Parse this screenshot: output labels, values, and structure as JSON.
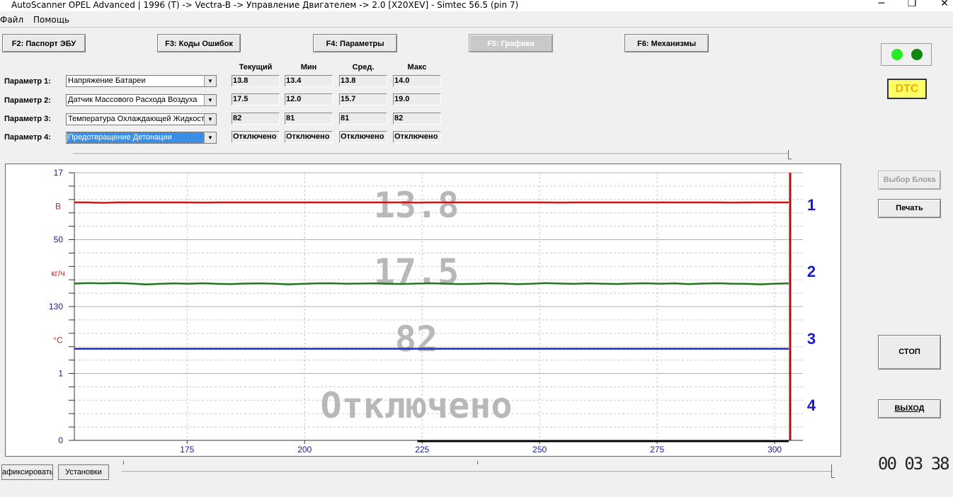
{
  "window": {
    "title": "AutoScanner OPEL Advanced | 1996 (T) -> Vectra-B -> Управление Двигателем -> 2.0 [X20XEV] - Simtec 56.5 (pin 7)",
    "minimize": "─",
    "maximize": "❐",
    "close": "✕"
  },
  "menu": [
    "Файл",
    "Помощь"
  ],
  "tabs": {
    "f2": "F2:  Паспорт ЭБУ",
    "f3": "F3:  Коды Ошибок",
    "f4": "F4:  Параметры",
    "f5": "F5:  Графики",
    "f6": "F6:  Механизмы"
  },
  "columns": {
    "current": "Текущий",
    "min": "Мин",
    "avg": "Сред.",
    "max": "Макс"
  },
  "params": [
    {
      "label": "Параметр 1:",
      "name": "Напряжение Батареи",
      "current": "13.8",
      "min": "13.4",
      "avg": "13.8",
      "max": "14.0"
    },
    {
      "label": "Параметр 2:",
      "name": "Датчик Массового Расхода Воздуха",
      "current": "17.5",
      "min": "12.0",
      "avg": "15.7",
      "max": "19.0"
    },
    {
      "label": "Параметр 3:",
      "name": "Температура Охлаждающей Жидкост",
      "current": "82",
      "min": "81",
      "avg": "81",
      "max": "82"
    },
    {
      "label": "Параметр 4:",
      "name": "Предотвращение Детонации",
      "current": "Отключено",
      "min": "Отключено",
      "avg": "Отключено",
      "max": "Отключено"
    }
  ],
  "chart_data": {
    "type": "line",
    "x_ticks": [
      "175",
      "200",
      "225",
      "250",
      "275",
      "300"
    ],
    "xlim": [
      151,
      303
    ],
    "left_axis_labels": [
      {
        "text": "17",
        "kind": "value"
      },
      {
        "text": "В",
        "kind": "unit"
      },
      {
        "text": "50",
        "kind": "value"
      },
      {
        "text": "кг/ч",
        "kind": "unit"
      },
      {
        "text": "130",
        "kind": "value"
      },
      {
        "text": "°С",
        "kind": "unit"
      },
      {
        "text": "1",
        "kind": "value"
      },
      {
        "text": "0",
        "kind": "value"
      }
    ],
    "channel_numbers": [
      "1",
      "2",
      "3",
      "4"
    ],
    "overlay_values": [
      "13.8",
      "17.5",
      "82",
      "Отключено"
    ],
    "grid": true,
    "series": [
      {
        "color": "#dd1111",
        "ylim": [
          10,
          17
        ],
        "values": [
          13.9,
          13.9,
          13.85,
          13.9,
          13.9,
          13.9,
          13.9,
          13.9,
          13.9,
          13.88,
          13.9,
          13.9,
          13.9,
          13.9,
          13.9,
          13.9,
          13.9,
          13.9,
          13.9,
          13.9,
          13.9,
          13.9,
          13.9,
          13.9,
          13.88,
          13.9,
          13.9,
          13.9,
          13.9,
          13.9,
          13.9,
          13.9,
          13.9,
          13.9,
          13.88,
          13.9,
          13.9,
          13.9,
          13.9,
          13.9,
          13.9,
          13.9,
          13.9,
          13.9,
          13.9,
          13.9,
          13.88,
          13.9,
          13.9,
          13.9,
          13.9
        ]
      },
      {
        "color": "#1a7a1a",
        "ylim": [
          0,
          50
        ],
        "values": [
          17.2,
          17.5,
          17.3,
          17.6,
          17.2,
          16.5,
          17.0,
          17.3,
          17.1,
          17.4,
          17.0,
          16.8,
          17.2,
          17.3,
          17.1,
          16.6,
          17.0,
          17.3,
          17.4,
          17.1,
          17.2,
          17.3,
          17.0,
          16.9,
          17.2,
          17.4,
          17.1,
          16.8,
          17.0,
          17.3,
          17.2,
          16.7,
          17.1,
          17.5,
          17.2,
          17.0,
          17.3,
          17.1,
          16.9,
          17.2,
          17.4,
          17.1,
          17.3,
          16.8,
          17.2,
          17.4,
          17.1,
          17.0,
          16.6,
          17.1,
          17.3
        ]
      },
      {
        "color": "#1a2acc",
        "ylim": [
          130,
          0
        ],
        "values": [
          82,
          82,
          82,
          82,
          82,
          82,
          82,
          82,
          82,
          82,
          82,
          82,
          82,
          82,
          82,
          82,
          82,
          82,
          82,
          82,
          82,
          82,
          82,
          82,
          82,
          82,
          82,
          82,
          82,
          82,
          82,
          82,
          82,
          82,
          82,
          82,
          82,
          82,
          82,
          82,
          82,
          82,
          82,
          82,
          82,
          82,
          82,
          82,
          82,
          82,
          82
        ]
      }
    ]
  },
  "right_panel": {
    "dtc": "DTC",
    "select_block": "Выбор Блока",
    "print": "Печать",
    "stop": "СТОП",
    "exit": "ВЫХОД",
    "timer": "00 03 38",
    "led_colors": [
      "#22ee22",
      "#118811"
    ]
  },
  "bottom": {
    "record_btn": "афиксировать",
    "settings_btn": "Установки"
  }
}
